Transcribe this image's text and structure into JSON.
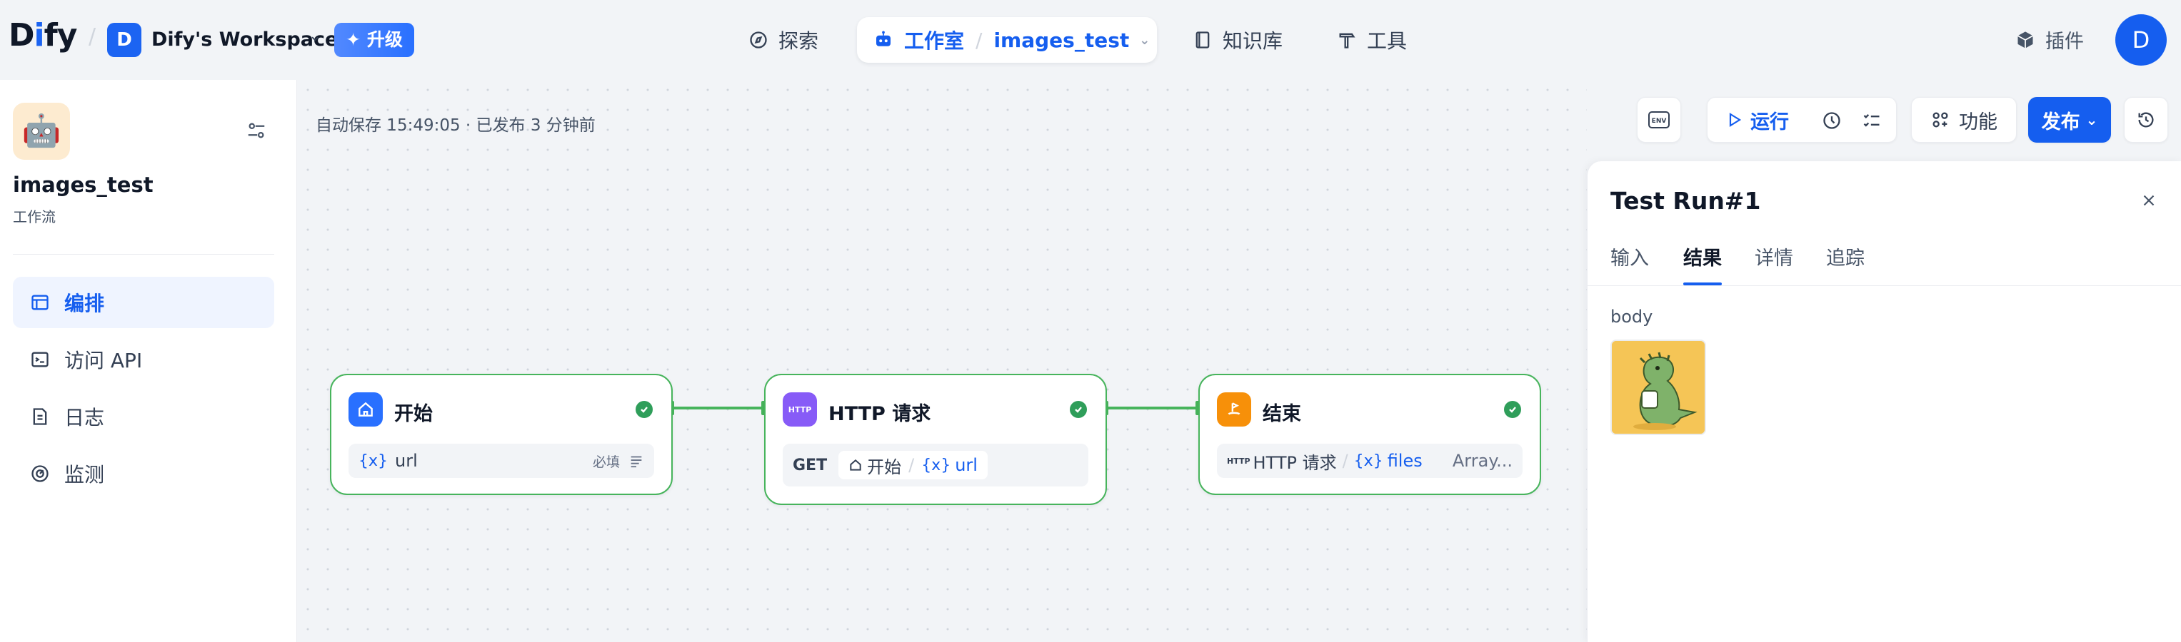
{
  "topbar": {
    "logo_prefix": "D",
    "logo_i": "i",
    "logo_suffix": "fy",
    "workspace_initial": "D",
    "workspace_name": "Dify's Workspace",
    "upgrade_label": "✦ 升级",
    "nav": {
      "explore": "探索",
      "studio": "工作室",
      "app_name": "images_test",
      "knowledge": "知识库",
      "tools": "工具"
    },
    "plugins_label": "插件",
    "user_initial": "D"
  },
  "sidebar": {
    "app_name": "images_test",
    "app_type": "工作流",
    "items": [
      {
        "label": "编排",
        "active": true
      },
      {
        "label": "访问 API",
        "active": false
      },
      {
        "label": "日志",
        "active": false
      },
      {
        "label": "监测",
        "active": false
      }
    ]
  },
  "canvas": {
    "autosave": "自动保存 15:49:05 · 已发布 3 分钟前",
    "toolbar": {
      "env": "ENV",
      "run": "运行",
      "features": "功能",
      "publish": "发布"
    },
    "nodes": {
      "start": {
        "title": "开始",
        "var": "url",
        "required": "必填"
      },
      "http": {
        "title": "HTTP 请求",
        "method": "GET",
        "ref_node": "开始",
        "ref_var": "url",
        "icon_text": "HTTP"
      },
      "end": {
        "title": "结束",
        "ref_node_icon": "HTTP",
        "ref_node": "HTTP 请求",
        "ref_var": "files",
        "type": "Array..."
      }
    }
  },
  "panel": {
    "title": "Test Run#1",
    "tabs": [
      "输入",
      "结果",
      "详情",
      "追踪"
    ],
    "active_tab": "结果",
    "body_label": "body"
  },
  "colors": {
    "accent": "#155eef",
    "success": "#47b45c",
    "start_icon": "#2970ff",
    "http_icon": "#875bf7",
    "end_icon": "#f79009"
  }
}
